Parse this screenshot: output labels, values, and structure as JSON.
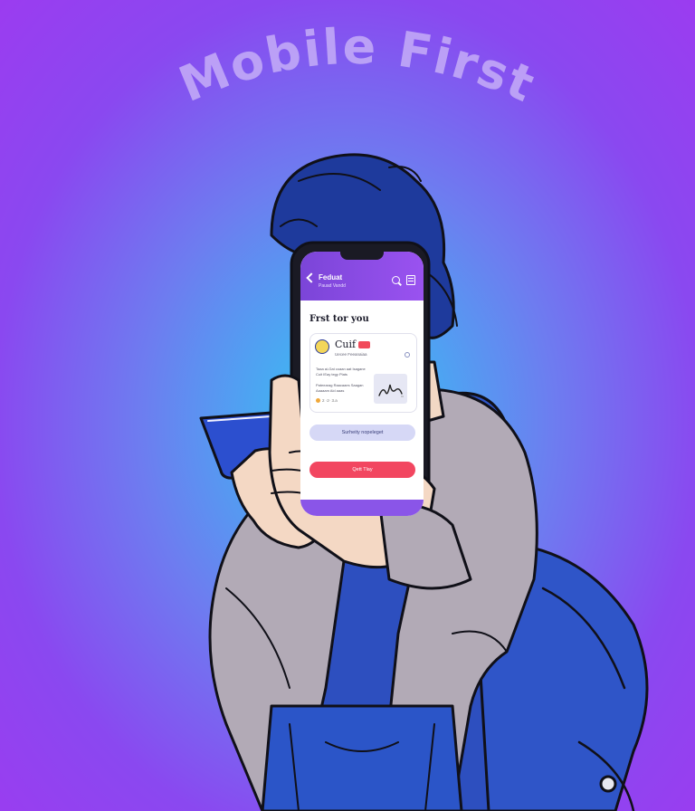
{
  "headline": "Mobile First",
  "phone_app": {
    "header": {
      "title": "Feduat",
      "subtitle": "Pauad Vandd"
    },
    "section_title": "Frst tor you",
    "card": {
      "name": "Cuif",
      "meta": "Uecee Feeanaiaa",
      "text_1": "Taaa ai-Gat coaan aat Isagane Cuit IEay tegy Plats",
      "text_2": "Pateearag Raacaaes Saagan Aaaaam Aid aaas",
      "stats": "2 ·2· 3.a"
    },
    "secondary_button": "Surheity nopeleget",
    "primary_button": "Qett Tlay"
  },
  "colors": {
    "accent": "#8a55e8",
    "primary_button": "#f24660",
    "background_center": "#33c9f0",
    "background_edge": "#9b3cf0"
  }
}
